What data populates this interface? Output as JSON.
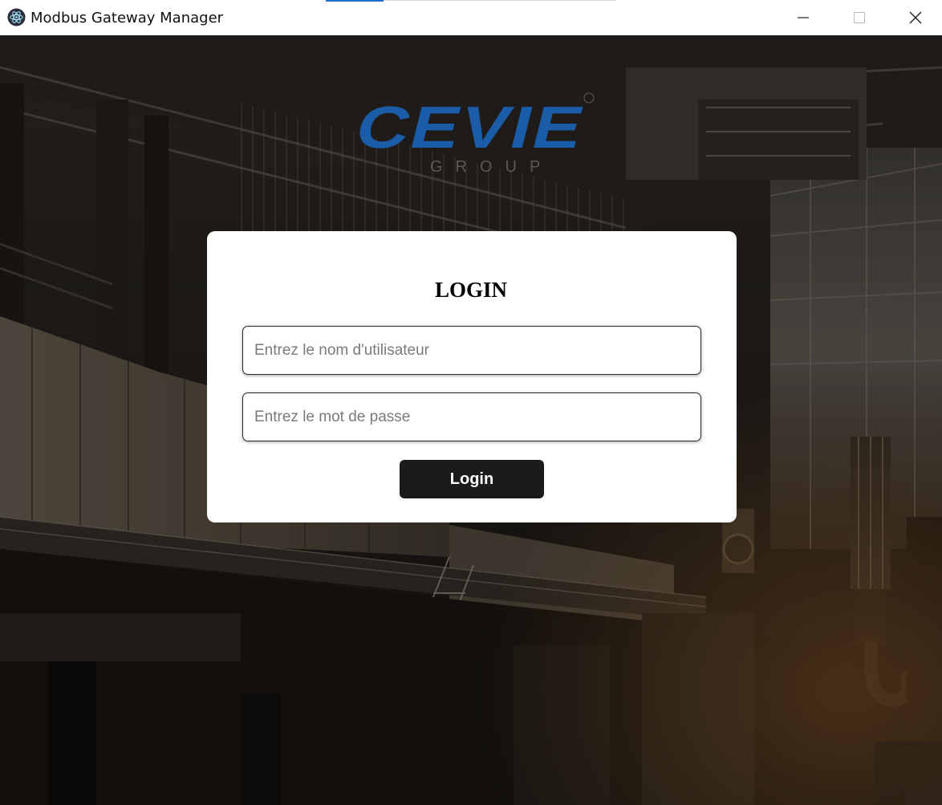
{
  "window": {
    "title": "Modbus Gateway Manager",
    "icon": "electron-atom-icon",
    "controls": [
      "minimize-icon",
      "maximize-icon",
      "close-icon"
    ]
  },
  "logo": {
    "text": "CEVIE",
    "subtext": "GROUP",
    "color": "#1a5ca8"
  },
  "login": {
    "title": "LOGIN",
    "username_placeholder": "Entrez le nom d'utilisateur",
    "password_placeholder": "Entrez le mot de passe",
    "button_label": "Login"
  },
  "colors": {
    "card_bg": "#ffffff",
    "button_bg": "#1c1a1a",
    "button_text": "#ffffff",
    "titlebar_accent": "#1f6fd1"
  }
}
